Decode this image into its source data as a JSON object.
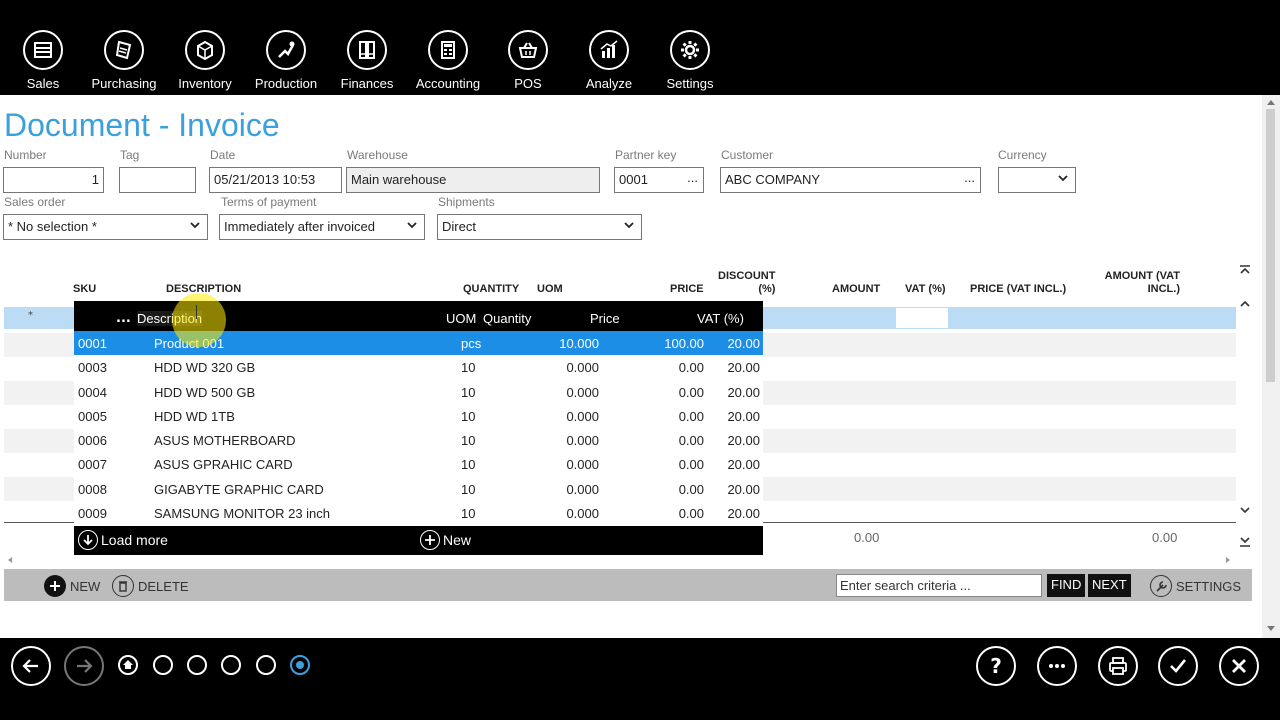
{
  "nav": [
    {
      "label": "Sales",
      "icon": "sales-icon"
    },
    {
      "label": "Purchasing",
      "icon": "purchasing-icon"
    },
    {
      "label": "Inventory",
      "icon": "inventory-icon"
    },
    {
      "label": "Production",
      "icon": "production-icon"
    },
    {
      "label": "Finances",
      "icon": "finances-icon"
    },
    {
      "label": "Accounting",
      "icon": "accounting-icon"
    },
    {
      "label": "POS",
      "icon": "pos-icon"
    },
    {
      "label": "Analyze",
      "icon": "analyze-icon"
    },
    {
      "label": "Settings",
      "icon": "gear-icon"
    }
  ],
  "page": {
    "title": "Document - Invoice"
  },
  "form": {
    "number": {
      "label": "Number",
      "value": "1"
    },
    "tag": {
      "label": "Tag",
      "value": ""
    },
    "date": {
      "label": "Date",
      "value": "05/21/2013 10:53"
    },
    "warehouse": {
      "label": "Warehouse",
      "value": "Main warehouse"
    },
    "partner_key": {
      "label": "Partner key",
      "value": "0001",
      "button": "..."
    },
    "customer": {
      "label": "Customer",
      "value": "ABC COMPANY",
      "button": "..."
    },
    "currency": {
      "label": "Currency",
      "value": ""
    },
    "sales_order": {
      "label": "Sales order",
      "value": "* No selection *"
    },
    "terms": {
      "label": "Terms of payment",
      "value": "Immediately after invoiced"
    },
    "shipments": {
      "label": "Shipments",
      "value": "Direct"
    }
  },
  "grid": {
    "headers": {
      "sku": "SKU",
      "description": "DESCRIPTION",
      "quantity": "QUANTITY",
      "uom": "UOM",
      "price": "PRICE",
      "discount_1": "DISCOUNT",
      "discount_2": "(%)",
      "amount": "AMOUNT",
      "vat": "VAT (%)",
      "price_vat": "PRICE (VAT INCL.)",
      "amount_vat_1": "AMOUNT (VAT",
      "amount_vat_2": "INCL.)"
    },
    "new_row_marker": "*",
    "sku_button": "...",
    "description_value": "Description",
    "total_amount": "0.00",
    "total_amount_vat": "0.00"
  },
  "lookup": {
    "headers": {
      "description": "Description",
      "uom": "UOM",
      "quantity": "Quantity",
      "price": "Price",
      "vat": "VAT (%)"
    },
    "rows": [
      {
        "sku": "0001",
        "name": "Product 001",
        "uom": "pcs",
        "qty": "10.000",
        "price": "100.00",
        "vat": "20.00"
      },
      {
        "sku": "0003",
        "name": "HDD WD 320 GB",
        "uom": "10",
        "qty": "0.000",
        "price": "0.00",
        "vat": "20.00"
      },
      {
        "sku": "0004",
        "name": "HDD WD 500 GB",
        "uom": "10",
        "qty": "0.000",
        "price": "0.00",
        "vat": "20.00"
      },
      {
        "sku": "0005",
        "name": "HDD WD 1TB",
        "uom": "10",
        "qty": "0.000",
        "price": "0.00",
        "vat": "20.00"
      },
      {
        "sku": "0006",
        "name": "ASUS MOTHERBOARD",
        "uom": "10",
        "qty": "0.000",
        "price": "0.00",
        "vat": "20.00"
      },
      {
        "sku": "0007",
        "name": "ASUS GPRAHIC CARD",
        "uom": "10",
        "qty": "0.000",
        "price": "0.00",
        "vat": "20.00"
      },
      {
        "sku": "0008",
        "name": "GIGABYTE GRAPHIC CARD",
        "uom": "10",
        "qty": "0.000",
        "price": "0.00",
        "vat": "20.00"
      },
      {
        "sku": "0009",
        "name": "SAMSUNG MONITOR 23 inch",
        "uom": "10",
        "qty": "0.000",
        "price": "0.00",
        "vat": "20.00"
      }
    ],
    "load_more": "Load more",
    "new": "New"
  },
  "toolbar": {
    "new": "NEW",
    "delete": "DELETE",
    "search_placeholder": "Enter search criteria ...",
    "find": "FIND",
    "next": "NEXT",
    "settings": "SETTINGS"
  },
  "colors": {
    "accent": "#3aa0de",
    "selection": "#1d8ee5",
    "active_row": "#bcdcf6"
  }
}
